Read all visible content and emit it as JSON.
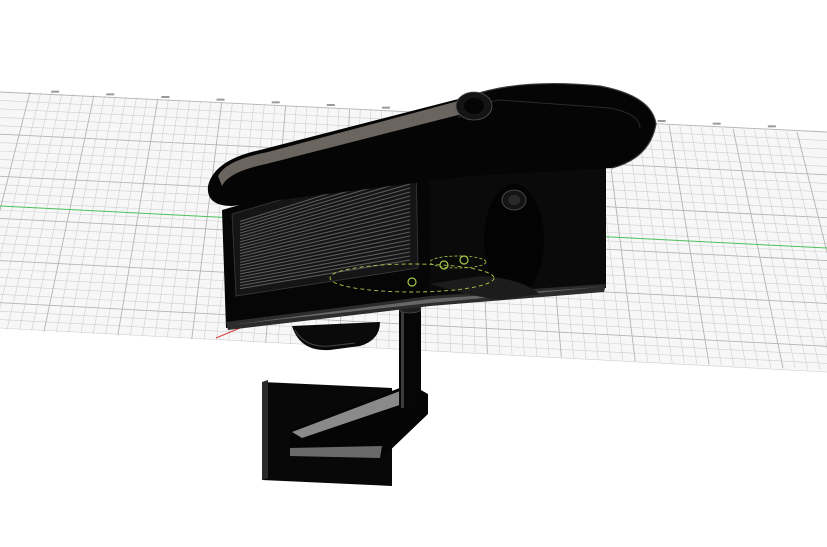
{
  "viewport": {
    "background": "#ffffff",
    "grid_color": "#c8c8c8",
    "x_axis_color": "#d23c3c",
    "y_axis_color": "#4cc05a"
  },
  "model": {
    "body_color": "#0b0b0b",
    "highlight_color": "#9a9a9a",
    "vent_color": "#5a5a5a",
    "selection_color": "#a8c84a",
    "components": [
      "camera-housing",
      "sun-shield",
      "vent-grille",
      "lens",
      "mount-pole",
      "wall-bracket"
    ]
  }
}
